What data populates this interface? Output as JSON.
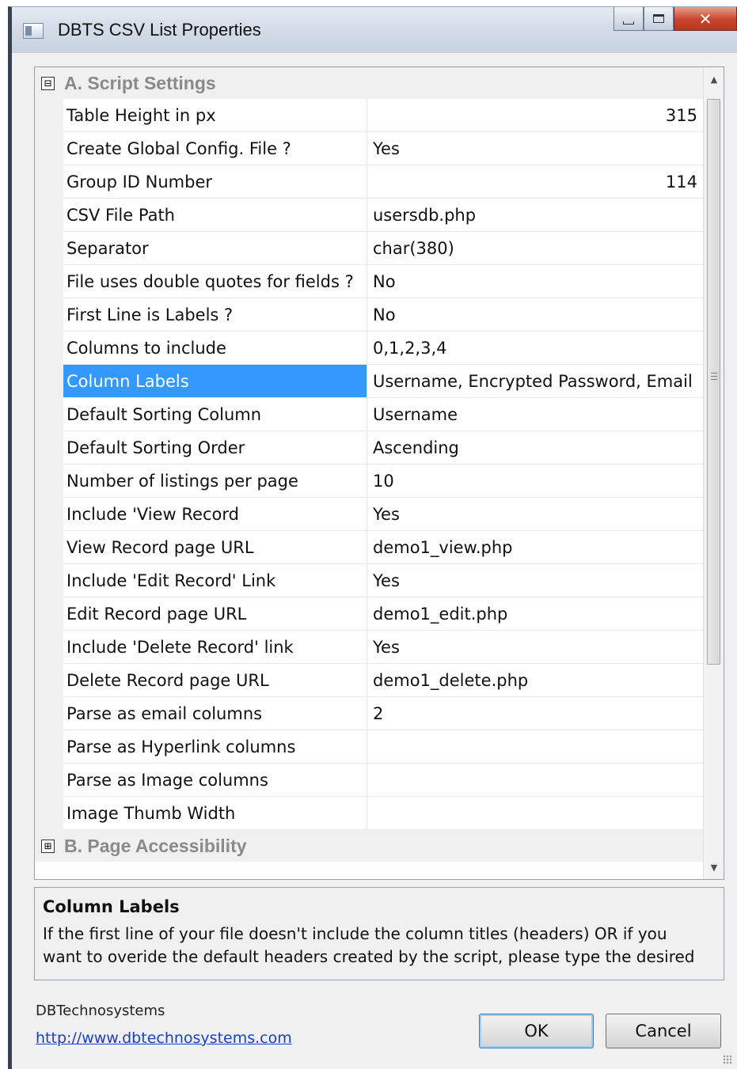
{
  "window": {
    "title": "DBTS CSV List Properties"
  },
  "grid": {
    "category_a": {
      "label": "A. Script Settings",
      "expander": "⊟"
    },
    "category_b": {
      "label": "B. Page Accessibility",
      "expander": "⊞"
    },
    "rows": [
      {
        "name": "Table Height in px",
        "value": "315",
        "numeric": true
      },
      {
        "name": "Create Global Config. File ?",
        "value": "Yes"
      },
      {
        "name": "Group ID Number",
        "value": "114",
        "numeric": true
      },
      {
        "name": "CSV File Path",
        "value": "usersdb.php"
      },
      {
        "name": "Separator",
        "value": "char(380)"
      },
      {
        "name": "File uses double quotes for fields ?",
        "value": "No"
      },
      {
        "name": "First Line is Labels ?",
        "value": "No"
      },
      {
        "name": "Columns to include",
        "value": "0,1,2,3,4"
      },
      {
        "name": "Column Labels",
        "value": "Username, Encrypted Password,  Email",
        "selected": true
      },
      {
        "name": "Default Sorting Column",
        "value": "Username"
      },
      {
        "name": "Default Sorting Order",
        "value": "Ascending"
      },
      {
        "name": "Number of listings per page",
        "value": "10"
      },
      {
        "name": "Include 'View Record",
        "value": "Yes"
      },
      {
        "name": "View Record page URL",
        "value": "demo1_view.php"
      },
      {
        "name": "Include 'Edit Record' Link",
        "value": "Yes"
      },
      {
        "name": "Edit Record page URL",
        "value": "demo1_edit.php"
      },
      {
        "name": "Include 'Delete Record' link",
        "value": "Yes"
      },
      {
        "name": "Delete Record page URL",
        "value": "demo1_delete.php"
      },
      {
        "name": "Parse as email columns",
        "value": "2"
      },
      {
        "name": "Parse as Hyperlink columns",
        "value": ""
      },
      {
        "name": "Parse as Image columns",
        "value": ""
      },
      {
        "name": "Image Thumb Width",
        "value": ""
      }
    ]
  },
  "help": {
    "title": "Column Labels",
    "line1": "If the first line of your file doesn't include the column titles (headers) OR if you",
    "line2": "want to overide the default headers created by the script, please type the desired"
  },
  "footer": {
    "company": "DBTechnosystems",
    "link": "http://www.dbtechnosystems.com",
    "ok_label": "OK",
    "cancel_label": "Cancel"
  }
}
